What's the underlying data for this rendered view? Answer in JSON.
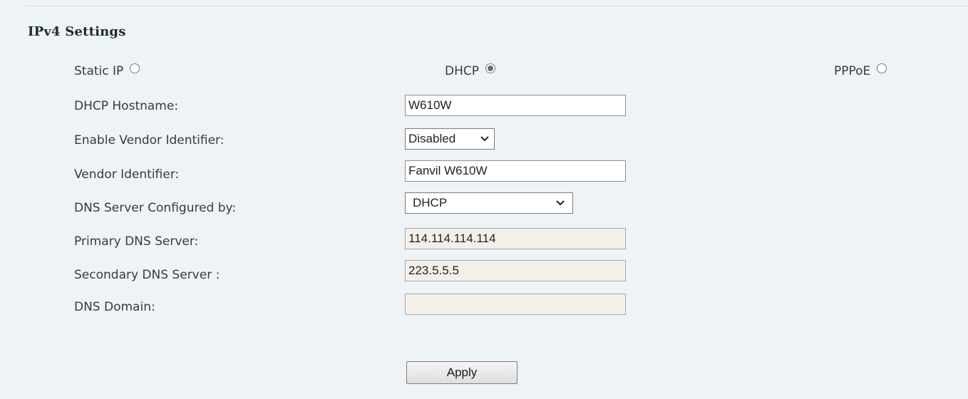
{
  "section": {
    "title": "IPv4 Settings"
  },
  "modes": {
    "static_ip": {
      "label": "Static IP",
      "checked": false
    },
    "dhcp": {
      "label": "DHCP",
      "checked": true
    },
    "pppoe": {
      "label": "PPPoE",
      "checked": false
    }
  },
  "fields": {
    "dhcp_hostname": {
      "label": "DHCP Hostname:",
      "value": "W610W"
    },
    "enable_vendor_identifier": {
      "label": "Enable Vendor Identifier:",
      "value": "Disabled"
    },
    "vendor_identifier": {
      "label": "Vendor Identifier:",
      "value": "Fanvil W610W"
    },
    "dns_configured_by": {
      "label": "DNS Server Configured by:",
      "value": "DHCP"
    },
    "primary_dns": {
      "label": "Primary DNS Server:",
      "value": "114.114.114.114"
    },
    "secondary_dns": {
      "label": "Secondary DNS Server :",
      "value": "223.5.5.5"
    },
    "dns_domain": {
      "label": "DNS Domain:",
      "value": ""
    }
  },
  "actions": {
    "apply_label": "Apply"
  },
  "icons": {
    "radio": "radio-button-icon",
    "dropdown": "chevron-down-icon"
  },
  "colors": {
    "background": "#eef3f6",
    "readonly_field": "#f3f0ea"
  }
}
